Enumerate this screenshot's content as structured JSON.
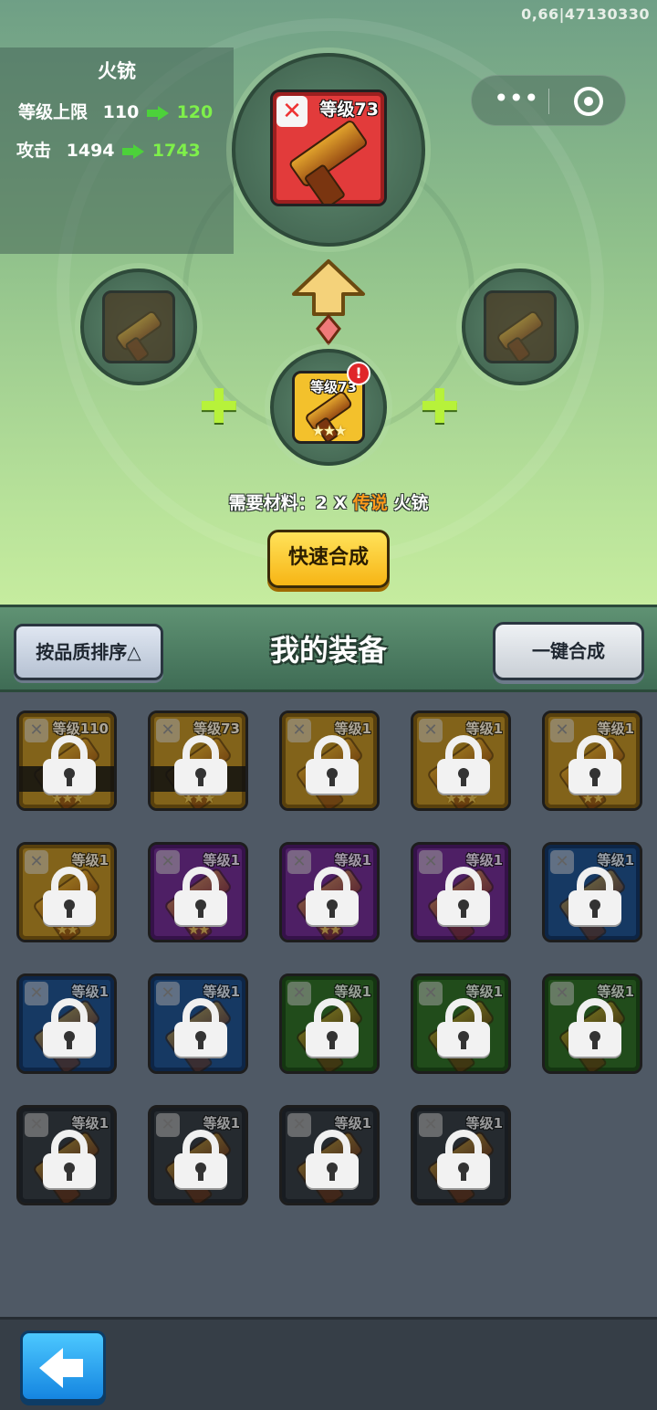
{
  "status": {
    "version_text": "0,66|47130330"
  },
  "weapon_info": {
    "name": "火铳",
    "level_cap_label": "等级上限",
    "level_cap_current": "110",
    "level_cap_next": "120",
    "attack_label": "攻击",
    "attack_current": "1494",
    "attack_next": "1743"
  },
  "main_item": {
    "level": "等级73",
    "quality_color": "#e23b3b"
  },
  "material_item": {
    "level": "等级73",
    "stars": "★★★",
    "alert": "!"
  },
  "requirement": {
    "prefix": "需要材料：2 X ",
    "quality": "传说",
    "item": " 火铳"
  },
  "buttons": {
    "fast_merge": "快速合成",
    "sort": "按品质排序△",
    "one_click_merge": "一键合成"
  },
  "section": {
    "title": "我的装备"
  },
  "icons": {
    "sword": "sword-icon",
    "lock": "lock-icon",
    "plus": "plus-icon",
    "upgrade_arrow": "arrow-up-icon",
    "back": "back-arrow-icon",
    "menu": "more-dots-icon",
    "target": "target-icon"
  },
  "inventory": [
    {
      "level": "等级110",
      "quality": "gold",
      "stars": "★★★"
    },
    {
      "level": "等级73",
      "quality": "gold",
      "stars": "★★★"
    },
    {
      "level": "等级1",
      "quality": "gold",
      "stars": ""
    },
    {
      "level": "等级1",
      "quality": "gold",
      "stars": "★★★"
    },
    {
      "level": "等级1",
      "quality": "gold",
      "stars": "★★"
    },
    {
      "level": "等级1",
      "quality": "gold",
      "stars": "★★"
    },
    {
      "level": "等级1",
      "quality": "purple",
      "stars": "★★"
    },
    {
      "level": "等级1",
      "quality": "purple",
      "stars": "★★"
    },
    {
      "level": "等级1",
      "quality": "purple",
      "stars": ""
    },
    {
      "level": "等级1",
      "quality": "blue",
      "stars": ""
    },
    {
      "level": "等级1",
      "quality": "blue",
      "stars": ""
    },
    {
      "level": "等级1",
      "quality": "blue",
      "stars": ""
    },
    {
      "level": "等级1",
      "quality": "green",
      "stars": ""
    },
    {
      "level": "等级1",
      "quality": "green",
      "stars": ""
    },
    {
      "level": "等级1",
      "quality": "green",
      "stars": ""
    },
    {
      "level": "等级1",
      "quality": "gray",
      "stars": ""
    },
    {
      "level": "等级1",
      "quality": "gray",
      "stars": ""
    },
    {
      "level": "等级1",
      "quality": "gray",
      "stars": ""
    },
    {
      "level": "等级1",
      "quality": "gray",
      "stars": ""
    }
  ]
}
